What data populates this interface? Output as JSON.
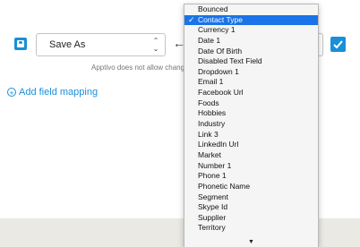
{
  "mapping_row": {
    "source_select_value": "Save As",
    "arrow_glyph": "←",
    "note": "Apptivo does not allow change"
  },
  "add_field_mapping": "Add field mapping",
  "dropdown": {
    "items": [
      "Bounced",
      "Contact Type",
      "Currency 1",
      "Date 1",
      "Date Of Birth",
      "Disabled Text Field",
      "Dropdown 1",
      "Email 1",
      "Facebook Url",
      "Foods",
      "Hobbies",
      "Industry",
      "Link 3",
      "LinkedIn Url",
      "Market",
      "Number 1",
      "Phone 1",
      "Phonetic Name",
      "Segment",
      "Skype Id",
      "Supplier",
      "Territory"
    ],
    "selected": "Contact Type",
    "check_glyph": "✓",
    "scroll_glyph": "▼"
  },
  "colors": {
    "accent": "#1a8fd8",
    "selection": "#1a73e8",
    "footer": "#ebe9e4"
  },
  "icons": [
    "contact-card-icon",
    "stepper-icon",
    "left-arrow-icon",
    "check-icon",
    "plus-circle-icon",
    "scroll-down-icon"
  ]
}
